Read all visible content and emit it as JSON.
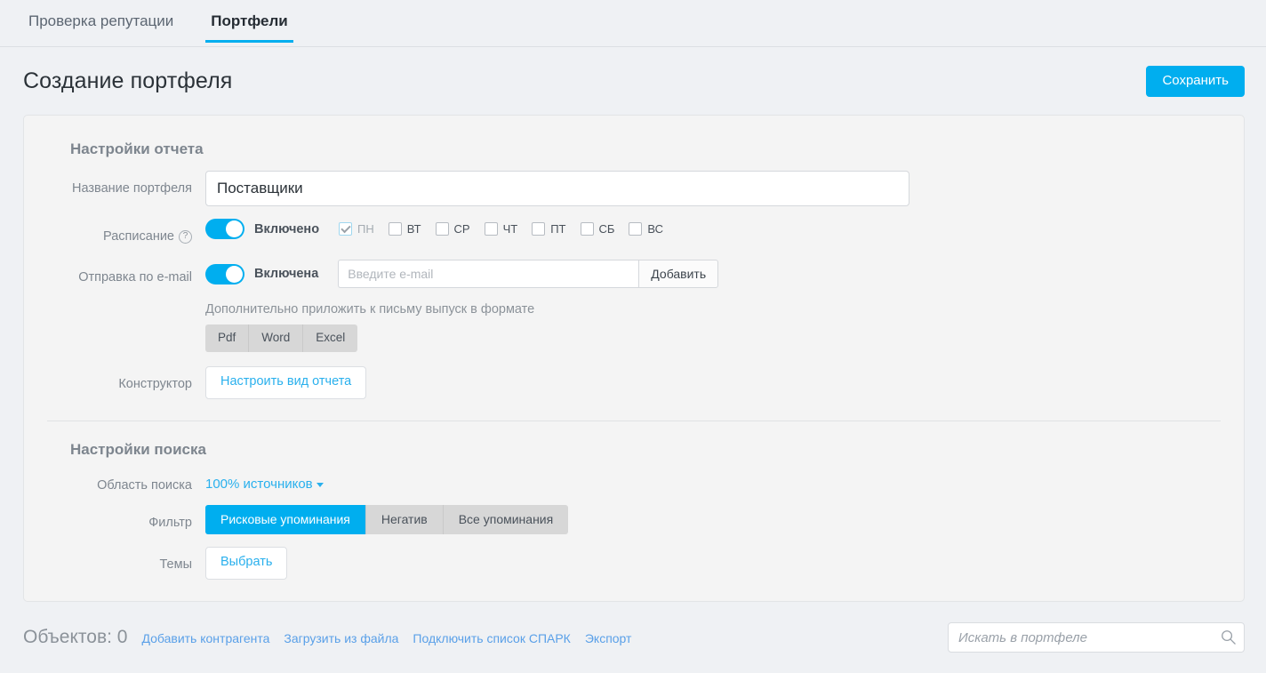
{
  "tabs": [
    {
      "label": "Проверка репутации",
      "active": false
    },
    {
      "label": "Портфели",
      "active": true
    }
  ],
  "header": {
    "title": "Создание портфеля",
    "save_label": "Сохранить"
  },
  "report_settings": {
    "section_title": "Настройки отчета",
    "name": {
      "label": "Название портфеля",
      "value": "Поставщики",
      "placeholder": ""
    },
    "schedule": {
      "label": "Расписание",
      "help_icon": "question-mark-icon",
      "toggle_state": "on",
      "toggle_text": "Включено",
      "days": [
        {
          "label": "ПН",
          "checked": true
        },
        {
          "label": "ВТ",
          "checked": false
        },
        {
          "label": "СР",
          "checked": false
        },
        {
          "label": "ЧТ",
          "checked": false
        },
        {
          "label": "ПТ",
          "checked": false
        },
        {
          "label": "СБ",
          "checked": false
        },
        {
          "label": "ВС",
          "checked": false
        }
      ]
    },
    "email": {
      "label": "Отправка по e-mail",
      "toggle_state": "on",
      "toggle_text": "Включена",
      "input_value": "",
      "input_placeholder": "Введите e-mail",
      "add_label": "Добавить",
      "hint": "Дополнительно приложить к письму выпуск в формате",
      "formats": [
        "Pdf",
        "Word",
        "Excel"
      ]
    },
    "constructor": {
      "label": "Конструктор",
      "button_label": "Настроить вид отчета"
    }
  },
  "search_settings": {
    "section_title": "Настройки поиска",
    "scope": {
      "label": "Область поиска",
      "value": "100% источников"
    },
    "filter": {
      "label": "Фильтр",
      "options": [
        {
          "label": "Рисковые упоминания",
          "active": true
        },
        {
          "label": "Негатив",
          "active": false
        },
        {
          "label": "Все упоминания",
          "active": false
        }
      ]
    },
    "topics": {
      "label": "Темы",
      "button_label": "Выбрать"
    }
  },
  "footer": {
    "objects_text": "Объектов: 0",
    "links": [
      "Добавить контрагента",
      "Загрузить из файла",
      "Подключить список СПАРК",
      "Экспорт"
    ],
    "search": {
      "value": "",
      "placeholder": "Искать в портфеле",
      "icon": "search-icon"
    }
  },
  "colors": {
    "accent": "#00aeef",
    "link": "#29b0ed",
    "footer_link": "#5aa0e8",
    "page_bg": "#eff1f4",
    "card_bg": "#f4f4f4"
  }
}
